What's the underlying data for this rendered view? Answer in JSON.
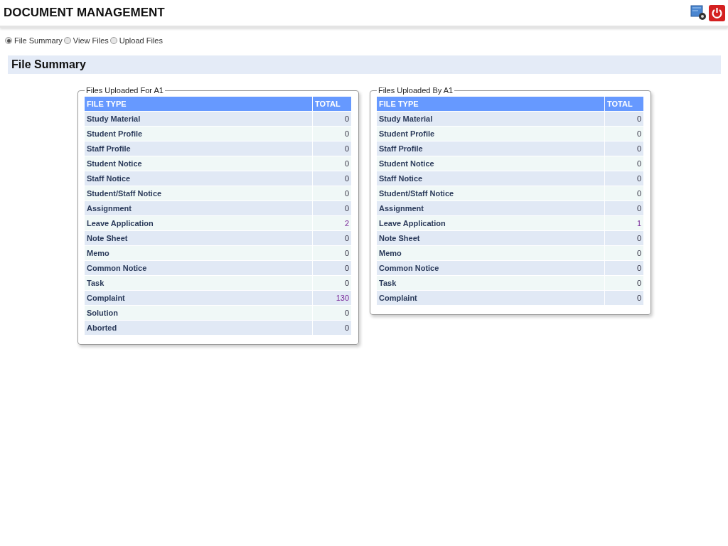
{
  "header": {
    "title": "DOCUMENT MANAGEMENT"
  },
  "view_options": [
    {
      "label": "File Summary",
      "selected": true
    },
    {
      "label": "View Files",
      "selected": false
    },
    {
      "label": "Upload Files",
      "selected": false
    }
  ],
  "section_title": "File Summary",
  "panels": [
    {
      "legend": "Files Uploaded For A1",
      "columns": [
        "FILE TYPE",
        "TOTAL"
      ],
      "rows": [
        {
          "type": "Study Material",
          "total": "0",
          "link": false
        },
        {
          "type": "Student Profile",
          "total": "0",
          "link": false
        },
        {
          "type": "Staff Profile",
          "total": "0",
          "link": false
        },
        {
          "type": "Student Notice",
          "total": "0",
          "link": false
        },
        {
          "type": "Staff Notice",
          "total": "0",
          "link": false
        },
        {
          "type": "Student/Staff Notice",
          "total": "0",
          "link": false
        },
        {
          "type": "Assignment",
          "total": "0",
          "link": false
        },
        {
          "type": "Leave Application",
          "total": "2",
          "link": true
        },
        {
          "type": "Note Sheet",
          "total": "0",
          "link": false
        },
        {
          "type": "Memo",
          "total": "0",
          "link": false
        },
        {
          "type": "Common Notice",
          "total": "0",
          "link": false
        },
        {
          "type": "Task",
          "total": "0",
          "link": false
        },
        {
          "type": "Complaint",
          "total": "130",
          "link": true
        },
        {
          "type": "Solution",
          "total": "0",
          "link": false
        },
        {
          "type": "Aborted",
          "total": "0",
          "link": false
        }
      ]
    },
    {
      "legend": "Files Uploaded By A1",
      "columns": [
        "FILE TYPE",
        "TOTAL"
      ],
      "rows": [
        {
          "type": "Study Material",
          "total": "0",
          "link": false
        },
        {
          "type": "Student Profile",
          "total": "0",
          "link": false
        },
        {
          "type": "Staff Profile",
          "total": "0",
          "link": false
        },
        {
          "type": "Student Notice",
          "total": "0",
          "link": false
        },
        {
          "type": "Staff Notice",
          "total": "0",
          "link": false
        },
        {
          "type": "Student/Staff Notice",
          "total": "0",
          "link": false
        },
        {
          "type": "Assignment",
          "total": "0",
          "link": false
        },
        {
          "type": "Leave Application",
          "total": "1",
          "link": true
        },
        {
          "type": "Note Sheet",
          "total": "0",
          "link": false
        },
        {
          "type": "Memo",
          "total": "0",
          "link": false
        },
        {
          "type": "Common Notice",
          "total": "0",
          "link": false
        },
        {
          "type": "Task",
          "total": "0",
          "link": false
        },
        {
          "type": "Complaint",
          "total": "0",
          "link": false
        }
      ]
    }
  ]
}
